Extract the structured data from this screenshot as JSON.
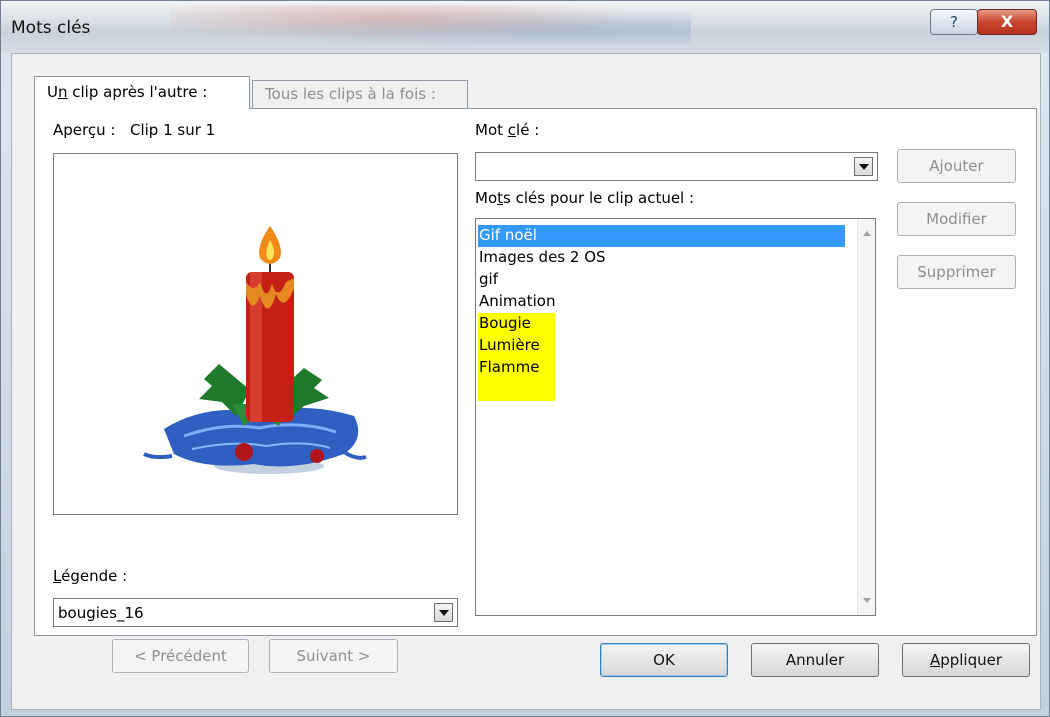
{
  "window": {
    "title": "Mots clés",
    "help_label": "?",
    "close_label": "X"
  },
  "tabs": [
    {
      "label_pre": "U",
      "label_underline": "n",
      "label_post": " clip après l'autre :"
    },
    {
      "label": "Tous les clips à la fois :"
    }
  ],
  "preview": {
    "label": "Aperçu :",
    "counter": "Clip 1 sur 1"
  },
  "caption": {
    "label_underline": "L",
    "label_post": "égende :",
    "value": "bougies_16"
  },
  "navigation": {
    "prev_label": "< Précédent",
    "next_label": "Suivant >"
  },
  "keyword": {
    "label_pre": "Mot ",
    "label_underline": "c",
    "label_post": "lé :",
    "value": ""
  },
  "keywords_list": {
    "label_pre": "Mo",
    "label_underline": "t",
    "label_post": "s clés pour le clip actuel :",
    "items": [
      {
        "text": "Gif noël",
        "state": "selected"
      },
      {
        "text": "Images des 2 OS",
        "state": "normal"
      },
      {
        "text": "gif",
        "state": "normal"
      },
      {
        "text": "Animation",
        "state": "normal"
      },
      {
        "text": "Bougie",
        "state": "highlight"
      },
      {
        "text": "Lumière",
        "state": "highlight"
      },
      {
        "text": "Flamme",
        "state": "highlight"
      }
    ]
  },
  "actions": {
    "add_label": "Ajouter",
    "modify_label": "Modifier",
    "delete_label": "Supprimer"
  },
  "footer": {
    "ok_label": "OK",
    "cancel_label": "Annuler",
    "apply_underline": "A",
    "apply_post": "ppliquer"
  },
  "colors": {
    "selection": "#3399ff",
    "highlight": "#ffff00"
  }
}
